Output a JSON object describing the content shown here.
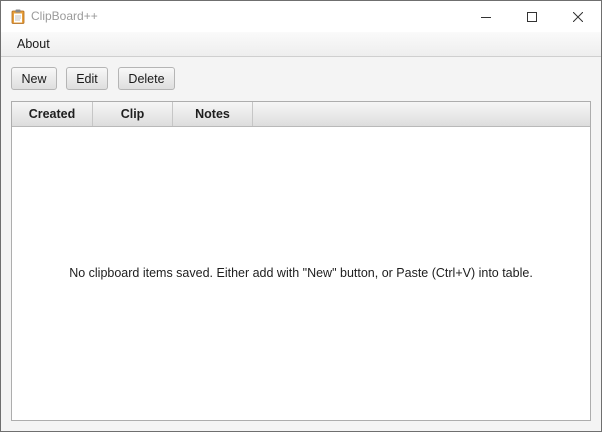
{
  "window": {
    "title": "ClipBoard++",
    "app_icon": "clipboard-icon",
    "controls": {
      "minimize_icon": "minimize-icon",
      "maximize_icon": "maximize-icon",
      "close_icon": "close-icon"
    }
  },
  "menubar": {
    "items": [
      {
        "label": "About"
      }
    ]
  },
  "toolbar": {
    "new_label": "New",
    "edit_label": "Edit",
    "delete_label": "Delete"
  },
  "table": {
    "columns": [
      "Created",
      "Clip",
      "Notes"
    ],
    "rows": [],
    "placeholder": "No clipboard items saved. Either add with \"New\" button, or Paste (Ctrl+V) into table."
  },
  "colors": {
    "title_text": "#9a9a9a",
    "window_border": "#6f6f6f",
    "table_border": "#adadad",
    "background": "#f4f4f4"
  }
}
